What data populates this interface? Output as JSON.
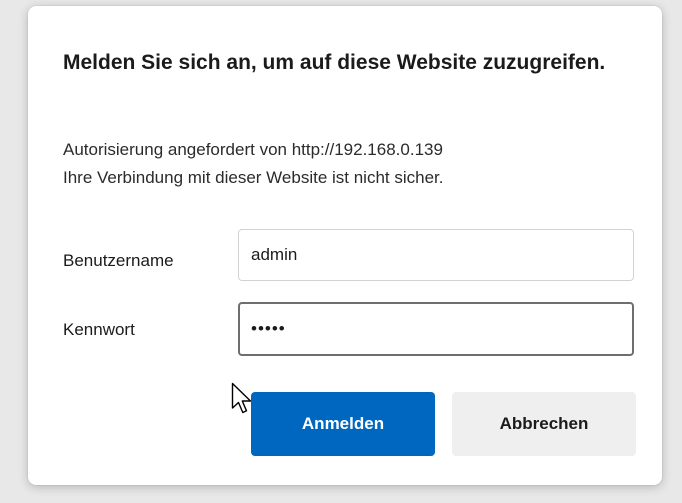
{
  "dialog": {
    "title": "Melden Sie sich an, um auf diese Website zuzugreifen.",
    "auth_requested": "Autorisierung angefordert von http://192.168.0.139",
    "connection_warning": "Ihre Verbindung mit dieser Website ist nicht sicher.",
    "username_label": "Benutzername",
    "username_value": "admin",
    "password_label": "Kennwort",
    "password_value": "•••••",
    "signin_button": "Anmelden",
    "cancel_button": "Abbrechen"
  },
  "colors": {
    "primary_button": "#0067c0",
    "secondary_button": "#efefef",
    "focused_input_border": "#6e6e6e"
  },
  "icons": {
    "cursor": "mouse-pointer-icon"
  }
}
